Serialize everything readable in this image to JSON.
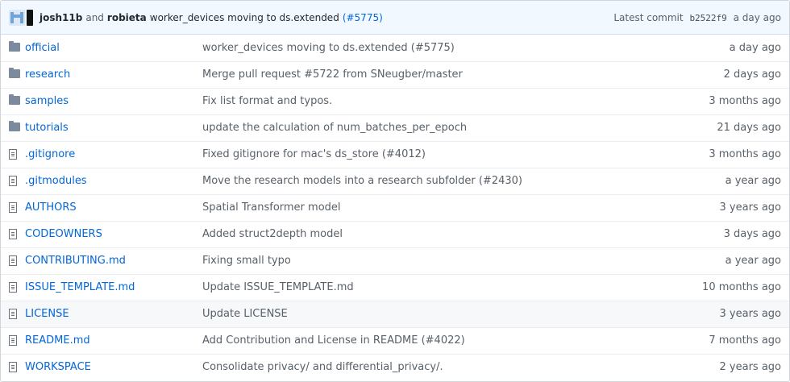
{
  "commit": {
    "author1": "josh11b",
    "and": "and",
    "author2": "robieta",
    "message": "worker_devices moving to ds.extended",
    "pr": "(#5775)",
    "latest_label": "Latest commit",
    "sha": "b2522f9",
    "age": "a day ago"
  },
  "files": [
    {
      "type": "folder",
      "name": "official",
      "message": "worker_devices moving to ds.extended (#5775)",
      "age": "a day ago"
    },
    {
      "type": "folder",
      "name": "research",
      "message": "Merge pull request #5722 from SNeugber/master",
      "age": "2 days ago"
    },
    {
      "type": "folder",
      "name": "samples",
      "message": "Fix list format and typos.",
      "age": "3 months ago"
    },
    {
      "type": "folder",
      "name": "tutorials",
      "message": "update the calculation of num_batches_per_epoch",
      "age": "21 days ago"
    },
    {
      "type": "file",
      "name": ".gitignore",
      "message": "Fixed gitignore for mac's ds_store (#4012)",
      "age": "3 months ago"
    },
    {
      "type": "file",
      "name": ".gitmodules",
      "message": "Move the research models into a research subfolder (#2430)",
      "age": "a year ago"
    },
    {
      "type": "file",
      "name": "AUTHORS",
      "message": "Spatial Transformer model",
      "age": "3 years ago"
    },
    {
      "type": "file",
      "name": "CODEOWNERS",
      "message": "Added struct2depth model",
      "age": "3 days ago"
    },
    {
      "type": "file",
      "name": "CONTRIBUTING.md",
      "message": "Fixing small typo",
      "age": "a year ago"
    },
    {
      "type": "file",
      "name": "ISSUE_TEMPLATE.md",
      "message": "Update ISSUE_TEMPLATE.md",
      "age": "10 months ago"
    },
    {
      "type": "file",
      "name": "LICENSE",
      "message": "Update LICENSE",
      "age": "3 years ago"
    },
    {
      "type": "file",
      "name": "README.md",
      "message": "Add Contribution and License in README (#4022)",
      "age": "7 months ago"
    },
    {
      "type": "file",
      "name": "WORKSPACE",
      "message": "Consolidate privacy/ and differential_privacy/.",
      "age": "2 years ago"
    }
  ],
  "highlighted_row": "LICENSE",
  "colors": {
    "link": "#0366d6",
    "folder": "#7b8a9c",
    "commit_bar": "#f1f8ff"
  }
}
